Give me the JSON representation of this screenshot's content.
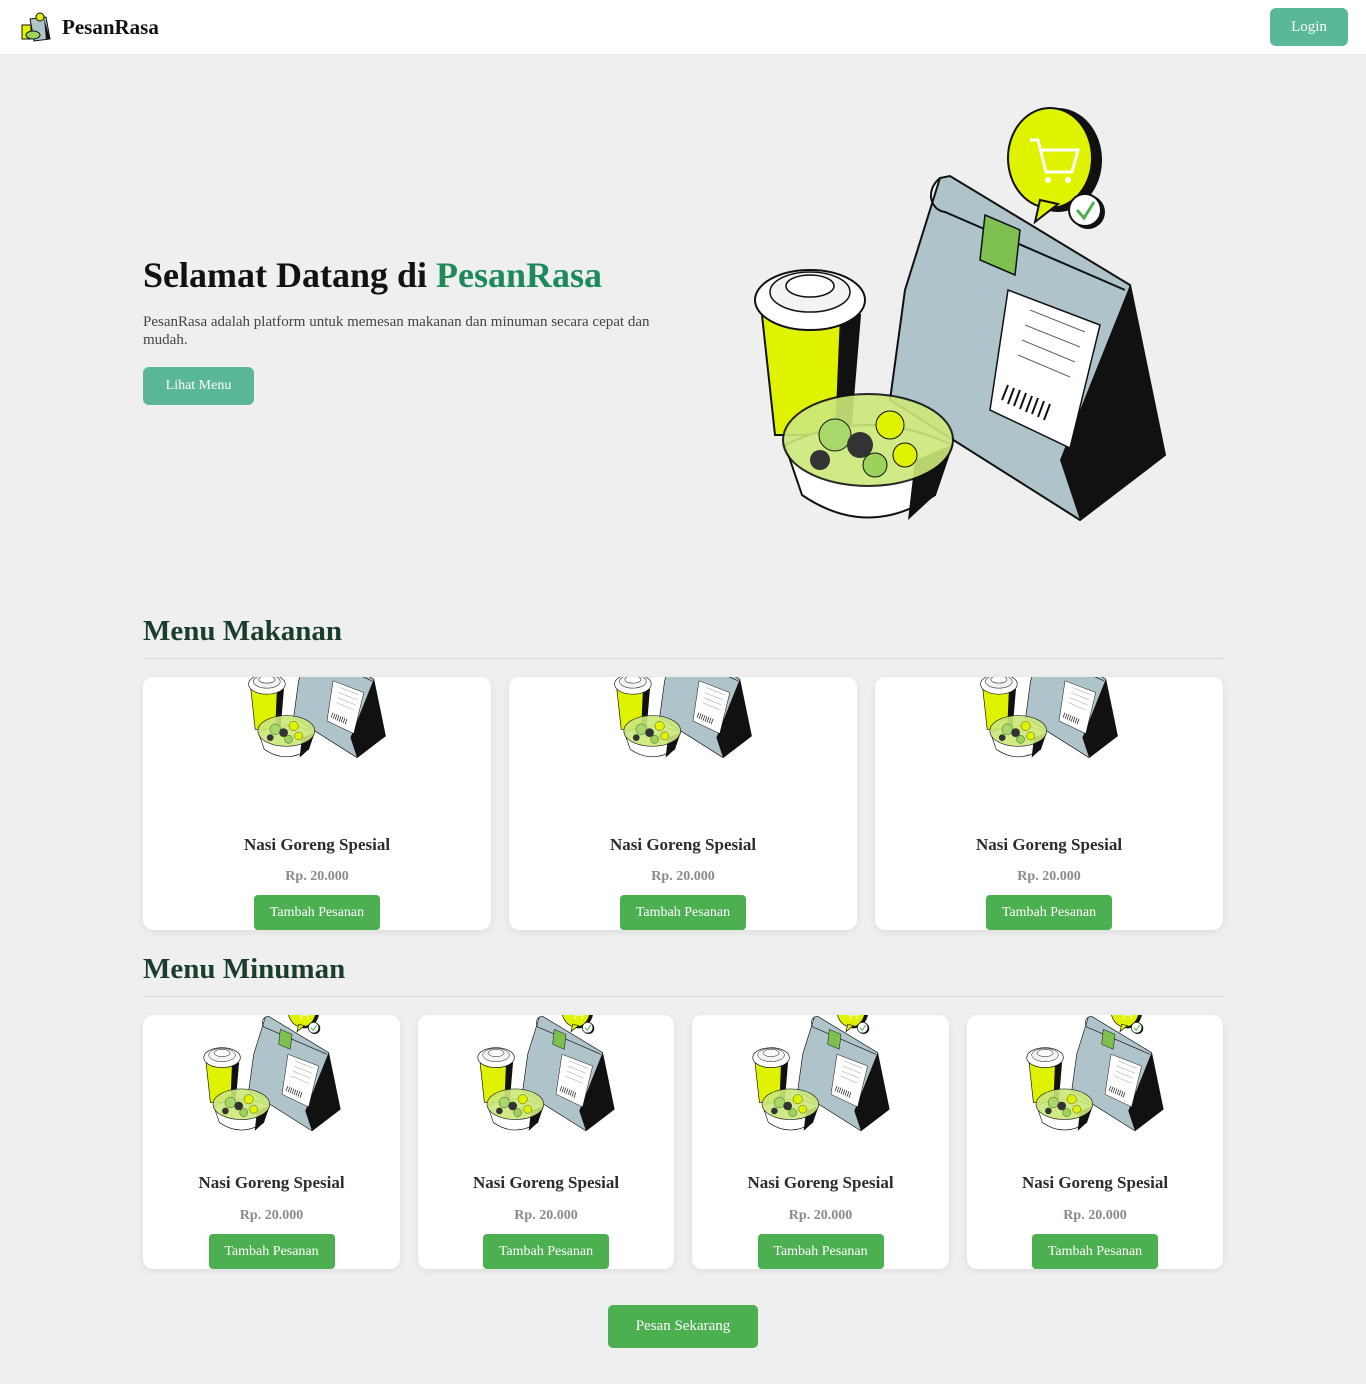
{
  "brand": {
    "name": "PesanRasa"
  },
  "nav": {
    "login_label": "Login"
  },
  "hero": {
    "title_prefix": "Selamat Datang di ",
    "title_accent": "PesanRasa",
    "description": "PesanRasa adalah platform untuk memesan makanan dan minuman secara cepat dan mudah.",
    "cta_label": "Lihat Menu"
  },
  "food_section": {
    "title": "Menu Makanan",
    "items": [
      {
        "name": "Nasi Goreng Spesial",
        "price": "Rp. 20.000",
        "button": "Tambah Pesanan"
      },
      {
        "name": "Nasi Goreng Spesial",
        "price": "Rp. 20.000",
        "button": "Tambah Pesanan"
      },
      {
        "name": "Nasi Goreng Spesial",
        "price": "Rp. 20.000",
        "button": "Tambah Pesanan"
      }
    ]
  },
  "drink_section": {
    "title": "Menu Minuman",
    "items": [
      {
        "name": "Nasi Goreng Spesial",
        "price": "Rp. 20.000",
        "button": "Tambah Pesanan"
      },
      {
        "name": "Nasi Goreng Spesial",
        "price": "Rp. 20.000",
        "button": "Tambah Pesanan"
      },
      {
        "name": "Nasi Goreng Spesial",
        "price": "Rp. 20.000",
        "button": "Tambah Pesanan"
      },
      {
        "name": "Nasi Goreng Spesial",
        "price": "Rp. 20.000",
        "button": "Tambah Pesanan"
      }
    ]
  },
  "order_now_label": "Pesan Sekarang",
  "colors": {
    "primary": "#5bb896",
    "button_green": "#4caf50",
    "accent_text": "#1d8a5c",
    "lime": "#dff200",
    "bag_gray": "#aec3ca"
  },
  "icons": {
    "logo": "food-delivery-logo-icon",
    "illustration": "food-delivery-illustration"
  }
}
